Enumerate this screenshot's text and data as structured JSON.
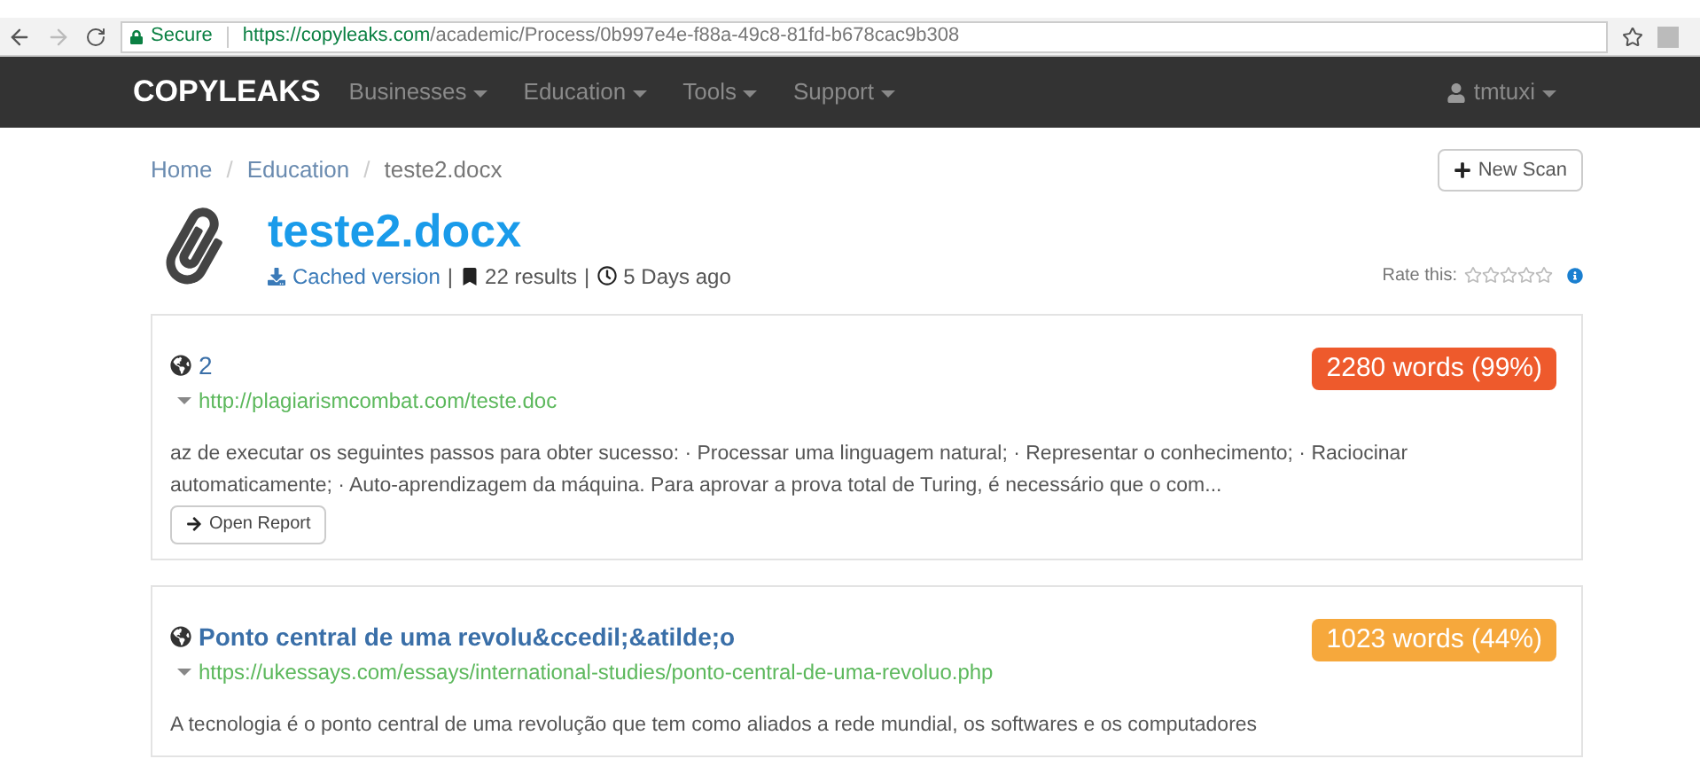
{
  "browser": {
    "secure_label": "Secure",
    "url_host": "https://copyleaks.com",
    "url_path": "/academic/Process/0b997e4e-f88a-49c8-81fd-b678cac9b308"
  },
  "navbar": {
    "logo": "COPYLEAKS",
    "menus": [
      "Businesses",
      "Education",
      "Tools",
      "Support"
    ],
    "user": "tmtuxi"
  },
  "breadcrumb": [
    {
      "label": "Home",
      "link": true
    },
    {
      "label": "Education",
      "link": true
    },
    {
      "label": "teste2.docx",
      "link": false
    }
  ],
  "breadcrumb_separator": "/",
  "meta_separator": "|",
  "new_scan_button": "New Scan",
  "document": {
    "title": "teste2.docx",
    "cached": "Cached version",
    "results": "22 results",
    "age": "5 Days ago"
  },
  "rating": {
    "label": "Rate this:",
    "stars": 0
  },
  "results": [
    {
      "title": "2",
      "url": "http://plagiarismcombat.com/teste.doc",
      "badge": "2280 words (99%)",
      "color": "#ee5a2c",
      "snippet": "az de executar os seguintes passos para obter sucesso: · Processar uma linguagem natural; · Representar o conhecimento; · Raciocinar automaticamente; · Auto-aprendizagem da máquina. Para aprovar a prova total de Turing, é necessário que o com...",
      "button": "Open Report"
    },
    {
      "title": "Ponto central de uma revolu&ccedil;&atilde;o",
      "url": "https://ukessays.com/essays/international-studies/ponto-central-de-uma-revoluo.php",
      "badge": "1023 words (44%)",
      "color": "#f6a83c",
      "snippet": "A tecnologia é o ponto central de uma revolução que tem como aliados a rede mundial, os softwares e os computadores"
    }
  ]
}
